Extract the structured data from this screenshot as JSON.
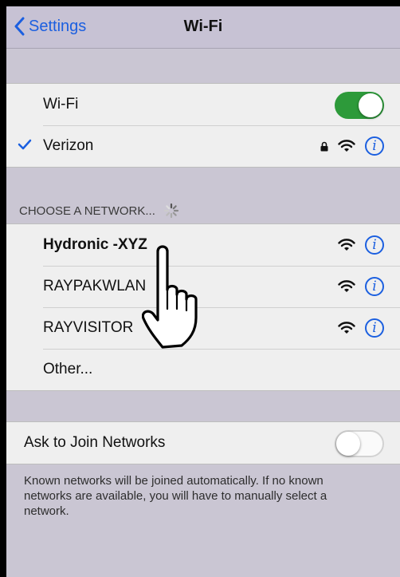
{
  "navbar": {
    "back_label": "Settings",
    "title": "Wi-Fi"
  },
  "wifi_toggle": {
    "label": "Wi-Fi",
    "state": "on"
  },
  "connected_network": {
    "name": "Verizon",
    "secured": true
  },
  "choose_network": {
    "header": "CHOOSE A NETWORK..."
  },
  "networks": [
    {
      "name": "Hydronic -XYZ",
      "bold": true
    },
    {
      "name": "RAYPAKWLAN",
      "bold": false
    },
    {
      "name": "RAYVISITOR",
      "bold": false
    }
  ],
  "other_label": "Other...",
  "ask_to_join": {
    "label": "Ask to Join Networks",
    "state": "off"
  },
  "footer_note": "Known networks will be joined automatically. If no known networks are available, you will have to manually select a network.",
  "colors": {
    "accent": "#1b5fe0",
    "toggle_on": "#2d9a3a",
    "background": "#cac6d3"
  },
  "icons": {
    "back": "chevron-left-icon",
    "check": "checkmark-icon",
    "lock": "lock-icon",
    "wifi": "wifi-icon",
    "info": "info-icon",
    "spinner": "spinner-icon",
    "hand": "hand-pointer-icon"
  }
}
